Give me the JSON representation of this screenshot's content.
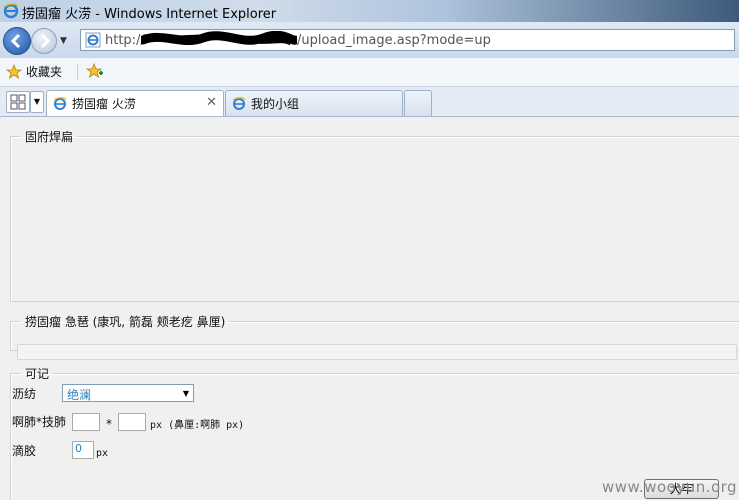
{
  "window": {
    "title": "捞固瘤 火涝 - Windows Internet Explorer"
  },
  "address_bar": {
    "url_prefix": "http://",
    "url_suffix": "/upload_image.asp?mode=up"
  },
  "favorites_bar": {
    "favorites_label": "收藏夹"
  },
  "tabs": [
    {
      "label": "捞固瘤 火涝",
      "active": true
    },
    {
      "label": "我的小组",
      "active": false
    }
  ],
  "content": {
    "preview_legend": "固府焊扁",
    "image_legend": "捞固瘤 急琶 (康巩, 箭磊 颊老疙 鼻厘)",
    "options_legend": "可记",
    "align_label": "沥纺",
    "align_value": "绝澜",
    "size_label": "啊肺*技肺",
    "size_separator": "*",
    "size_unit_note": "px (鼻厘:啊肺 px)",
    "border_label": "滴胶",
    "border_value": "0",
    "border_unit": "px",
    "ok_button": "犬牢"
  },
  "watermark": "www.wooyun.org",
  "colors": {
    "accent_link": "#2b84b8",
    "window_bg": "#f0f0f0"
  }
}
